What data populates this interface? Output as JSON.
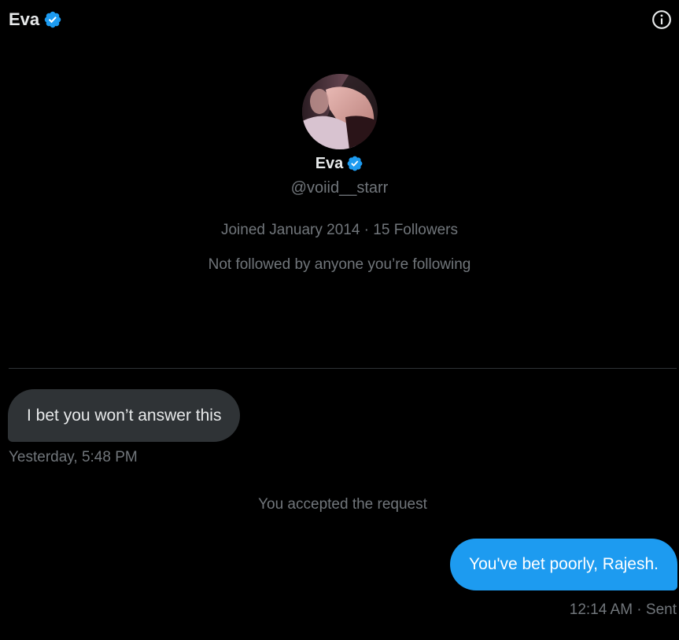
{
  "header": {
    "title": "Eva",
    "verified_icon": "verified-badge-icon",
    "info_icon": "info-icon"
  },
  "profile": {
    "name": "Eva",
    "handle": "@voiid__starr",
    "meta": "Joined January 2014 · 15 Followers",
    "mutuals": "Not followed by anyone you’re following"
  },
  "messages": [
    {
      "direction": "incoming",
      "text": "I bet you won’t answer this",
      "timestamp": "Yesterday, 5:48 PM"
    },
    {
      "direction": "system",
      "text": "You accepted the request"
    },
    {
      "direction": "outgoing",
      "text": "You've bet poorly, Rajesh.",
      "timestamp": "12:14 AM · Sent"
    }
  ],
  "colors": {
    "background": "#000000",
    "accent": "#1d9bf0",
    "incoming_bubble": "#2f3336",
    "muted_text": "#71767b",
    "primary_text": "#e7e9ea"
  }
}
